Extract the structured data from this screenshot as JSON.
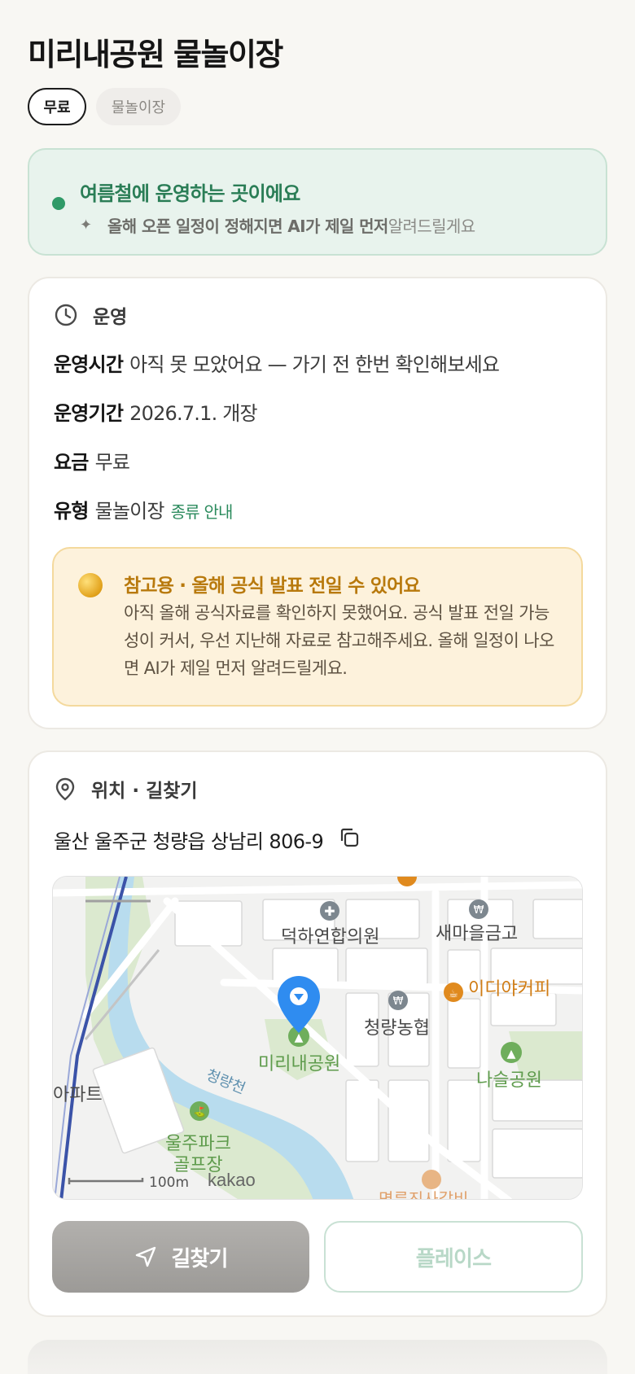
{
  "page": {
    "title": "미리내공원 물놀이장",
    "chips": [
      "무료",
      "물놀이장"
    ]
  },
  "notice": {
    "headline": "여름철에 운영하는 곳이에요",
    "sub_bold": "올해 오픈 일정이 정해지면 AI가 제일 먼저",
    "sub_rest": " 알려드릴게요",
    "accent": "#2f9a68"
  },
  "operation": {
    "section_title": "운영",
    "rows": [
      {
        "key": "운영시간",
        "value": "아직 못 모았어요 — 가기 전 한번 확인해보세요"
      },
      {
        "key": "운영기간",
        "value": "2026.7.1. 개장"
      },
      {
        "key": "요금",
        "value": "무료"
      },
      {
        "key": "유형",
        "value": "물놀이장",
        "link": "종류 안내"
      }
    ],
    "warning": {
      "title": "참고용 · 올해 공식 발표 전일 수 있어요",
      "body": "아직 올해 공식자료를 확인하지 못했어요. 공식 발표 전일 가능성이 커서, 우선 지난해 자료로 참고해주세요. 올해 일정이 나오면 AI가 제일 먼저 알려드릴게요."
    }
  },
  "location": {
    "section_title": "위치 · 길찾기",
    "address": "울산 울주군 청량읍 상남리 806-9",
    "map": {
      "labels": {
        "clinic": "덕하연합의원",
        "bank": "새마을금고",
        "cafe": "이디야커피",
        "bank2": "청량농협",
        "park": "미리내공원",
        "park2": "나슬공원",
        "river": "청량천",
        "apt": "아파트",
        "golf_line1": "울주파크",
        "golf_line2": "골프장",
        "restaurant": "명륜진사갈비",
        "scale": "100m",
        "brand": "kakao"
      }
    },
    "buttons": {
      "nav": "길찾기",
      "place": "플레이스"
    }
  }
}
